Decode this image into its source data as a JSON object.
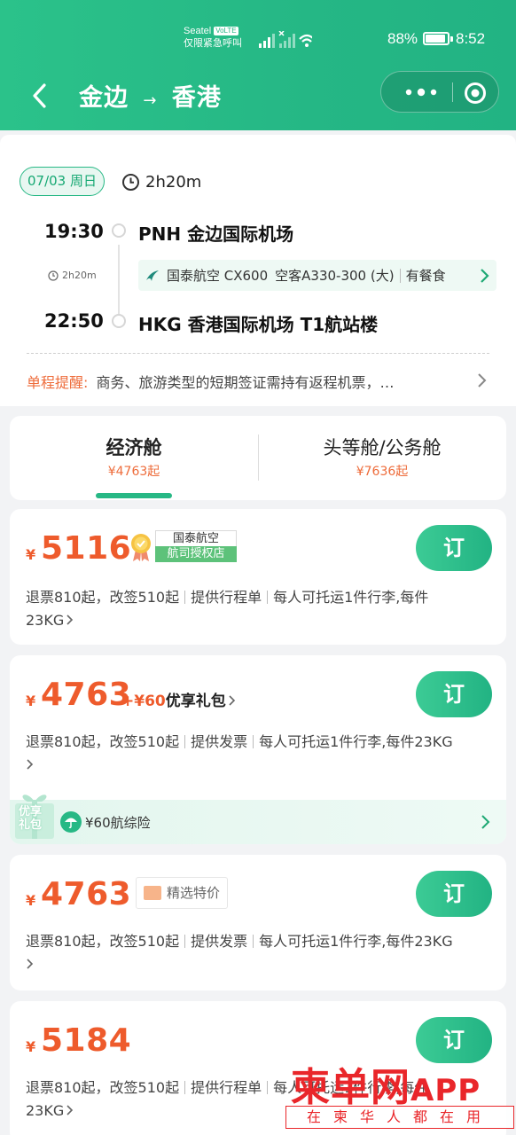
{
  "status_bar": {
    "carrier": "Seatel",
    "volte": "VoLTE",
    "emergency": "仅限紧急呼叫",
    "battery": "88%",
    "time": "8:52"
  },
  "header": {
    "origin": "金边",
    "arrow": "→",
    "destination": "香港"
  },
  "flight": {
    "date": "07/03 周日",
    "duration": "2h20m",
    "depart_time": "19:30",
    "depart_airport": "PNH 金边国际机场",
    "segment_duration": "2h20m",
    "airline_info": "国泰航空 CX600",
    "aircraft": "空客A330-300 (大)",
    "meal": "有餐食",
    "arrive_time": "22:50",
    "arrive_airport": "HKG 香港国际机场 T1航站楼",
    "reminder_label": "单程提醒:",
    "reminder_text": "商务、旅游类型的短期签证需持有返程机票，…"
  },
  "cabin_tabs": [
    {
      "name": "经济舱",
      "price": "¥4763起"
    },
    {
      "name": "头等舱/公务舱",
      "price": "¥7636起"
    }
  ],
  "fares": [
    {
      "yen": "¥",
      "price": "5116",
      "agency_top": "国泰航空",
      "agency_bottom": "航司授权店",
      "rule1": "退票810起，改签510起",
      "rule2": "提供行程单",
      "rule3": "每人可托运1件行李,每件",
      "rule4": "23KG",
      "book": "订"
    },
    {
      "yen": "¥",
      "price": "4763",
      "gift_amount": "+¥60",
      "gift_name": "优享礼包",
      "rule1": "退票810起，改签510起",
      "rule2": "提供发票",
      "rule3": "每人可托运1件行李,每件23KG",
      "gift_badge": "优享礼包",
      "gift_item": "¥60航综险",
      "book": "订"
    },
    {
      "yen": "¥",
      "price": "4763",
      "tag": "精选特价",
      "rule1": "退票810起，改签510起",
      "rule2": "提供发票",
      "rule3": "每人可托运1件行李,每件23KG",
      "book": "订"
    },
    {
      "yen": "¥",
      "price": "5184",
      "rule1": "退票810起，改签510起",
      "rule2": "提供行程单",
      "rule3": "每人可托运1件行李,每件",
      "rule4": "23KG",
      "book": "订"
    }
  ],
  "watermark": {
    "main": "柬单网",
    "app": "APP",
    "slogan": "在柬华人都在用"
  },
  "colors": {
    "brand_green": "#27b885",
    "price_orange": "#ee5b2c",
    "watermark_red": "#e9262a"
  }
}
